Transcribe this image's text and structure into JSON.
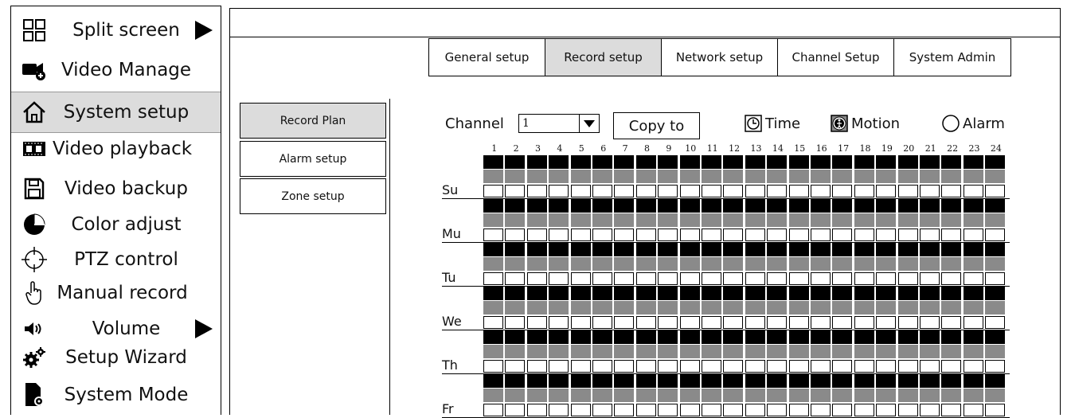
{
  "menu": {
    "items": [
      {
        "label": "Split screen",
        "icon": "split-screen-icon",
        "submenu": true
      },
      {
        "label": "Video Manage",
        "icon": "video-manage-icon"
      },
      {
        "label": "System setup",
        "icon": "home-icon",
        "active": true
      },
      {
        "label": "Video playback",
        "icon": "video-playback-icon"
      },
      {
        "label": "Video backup",
        "icon": "save-icon"
      },
      {
        "label": "Color adjust",
        "icon": "color-adjust-icon"
      },
      {
        "label": "PTZ control",
        "icon": "crosshair-icon"
      },
      {
        "label": "Manual record",
        "icon": "hand-pointer-icon"
      },
      {
        "label": "Volume",
        "icon": "speaker-icon",
        "submenu": true
      },
      {
        "label": "Setup Wizard",
        "icon": "gears-icon"
      },
      {
        "label": "System Mode",
        "icon": "system-mode-icon"
      }
    ]
  },
  "tabs": [
    {
      "label": "General setup"
    },
    {
      "label": "Record setup",
      "selected": true
    },
    {
      "label": "Network setup"
    },
    {
      "label": "Channel Setup"
    },
    {
      "label": "System Admin"
    }
  ],
  "side_buttons": [
    {
      "label": "Record Plan",
      "selected": true
    },
    {
      "label": "Alarm setup"
    },
    {
      "label": "Zone setup"
    }
  ],
  "record_plan": {
    "channel_label": "Channel",
    "channel_value": "1",
    "copy_label": "Copy to",
    "legend": {
      "time": "Time",
      "motion": "Motion",
      "alarm": "Alarm"
    },
    "hours": [
      "1",
      "2",
      "3",
      "4",
      "5",
      "6",
      "7",
      "8",
      "9",
      "10",
      "11",
      "12",
      "13",
      "14",
      "15",
      "16",
      "17",
      "18",
      "19",
      "20",
      "21",
      "22",
      "23",
      "24"
    ],
    "days": [
      "Su",
      "Mu",
      "Tu",
      "We",
      "Th",
      "Fr"
    ]
  },
  "colors": {
    "active_bg": "#dcdcdc",
    "time_fill": "#000000",
    "motion_fill": "#8a8a8a",
    "alarm_fill": "#ffffff"
  }
}
